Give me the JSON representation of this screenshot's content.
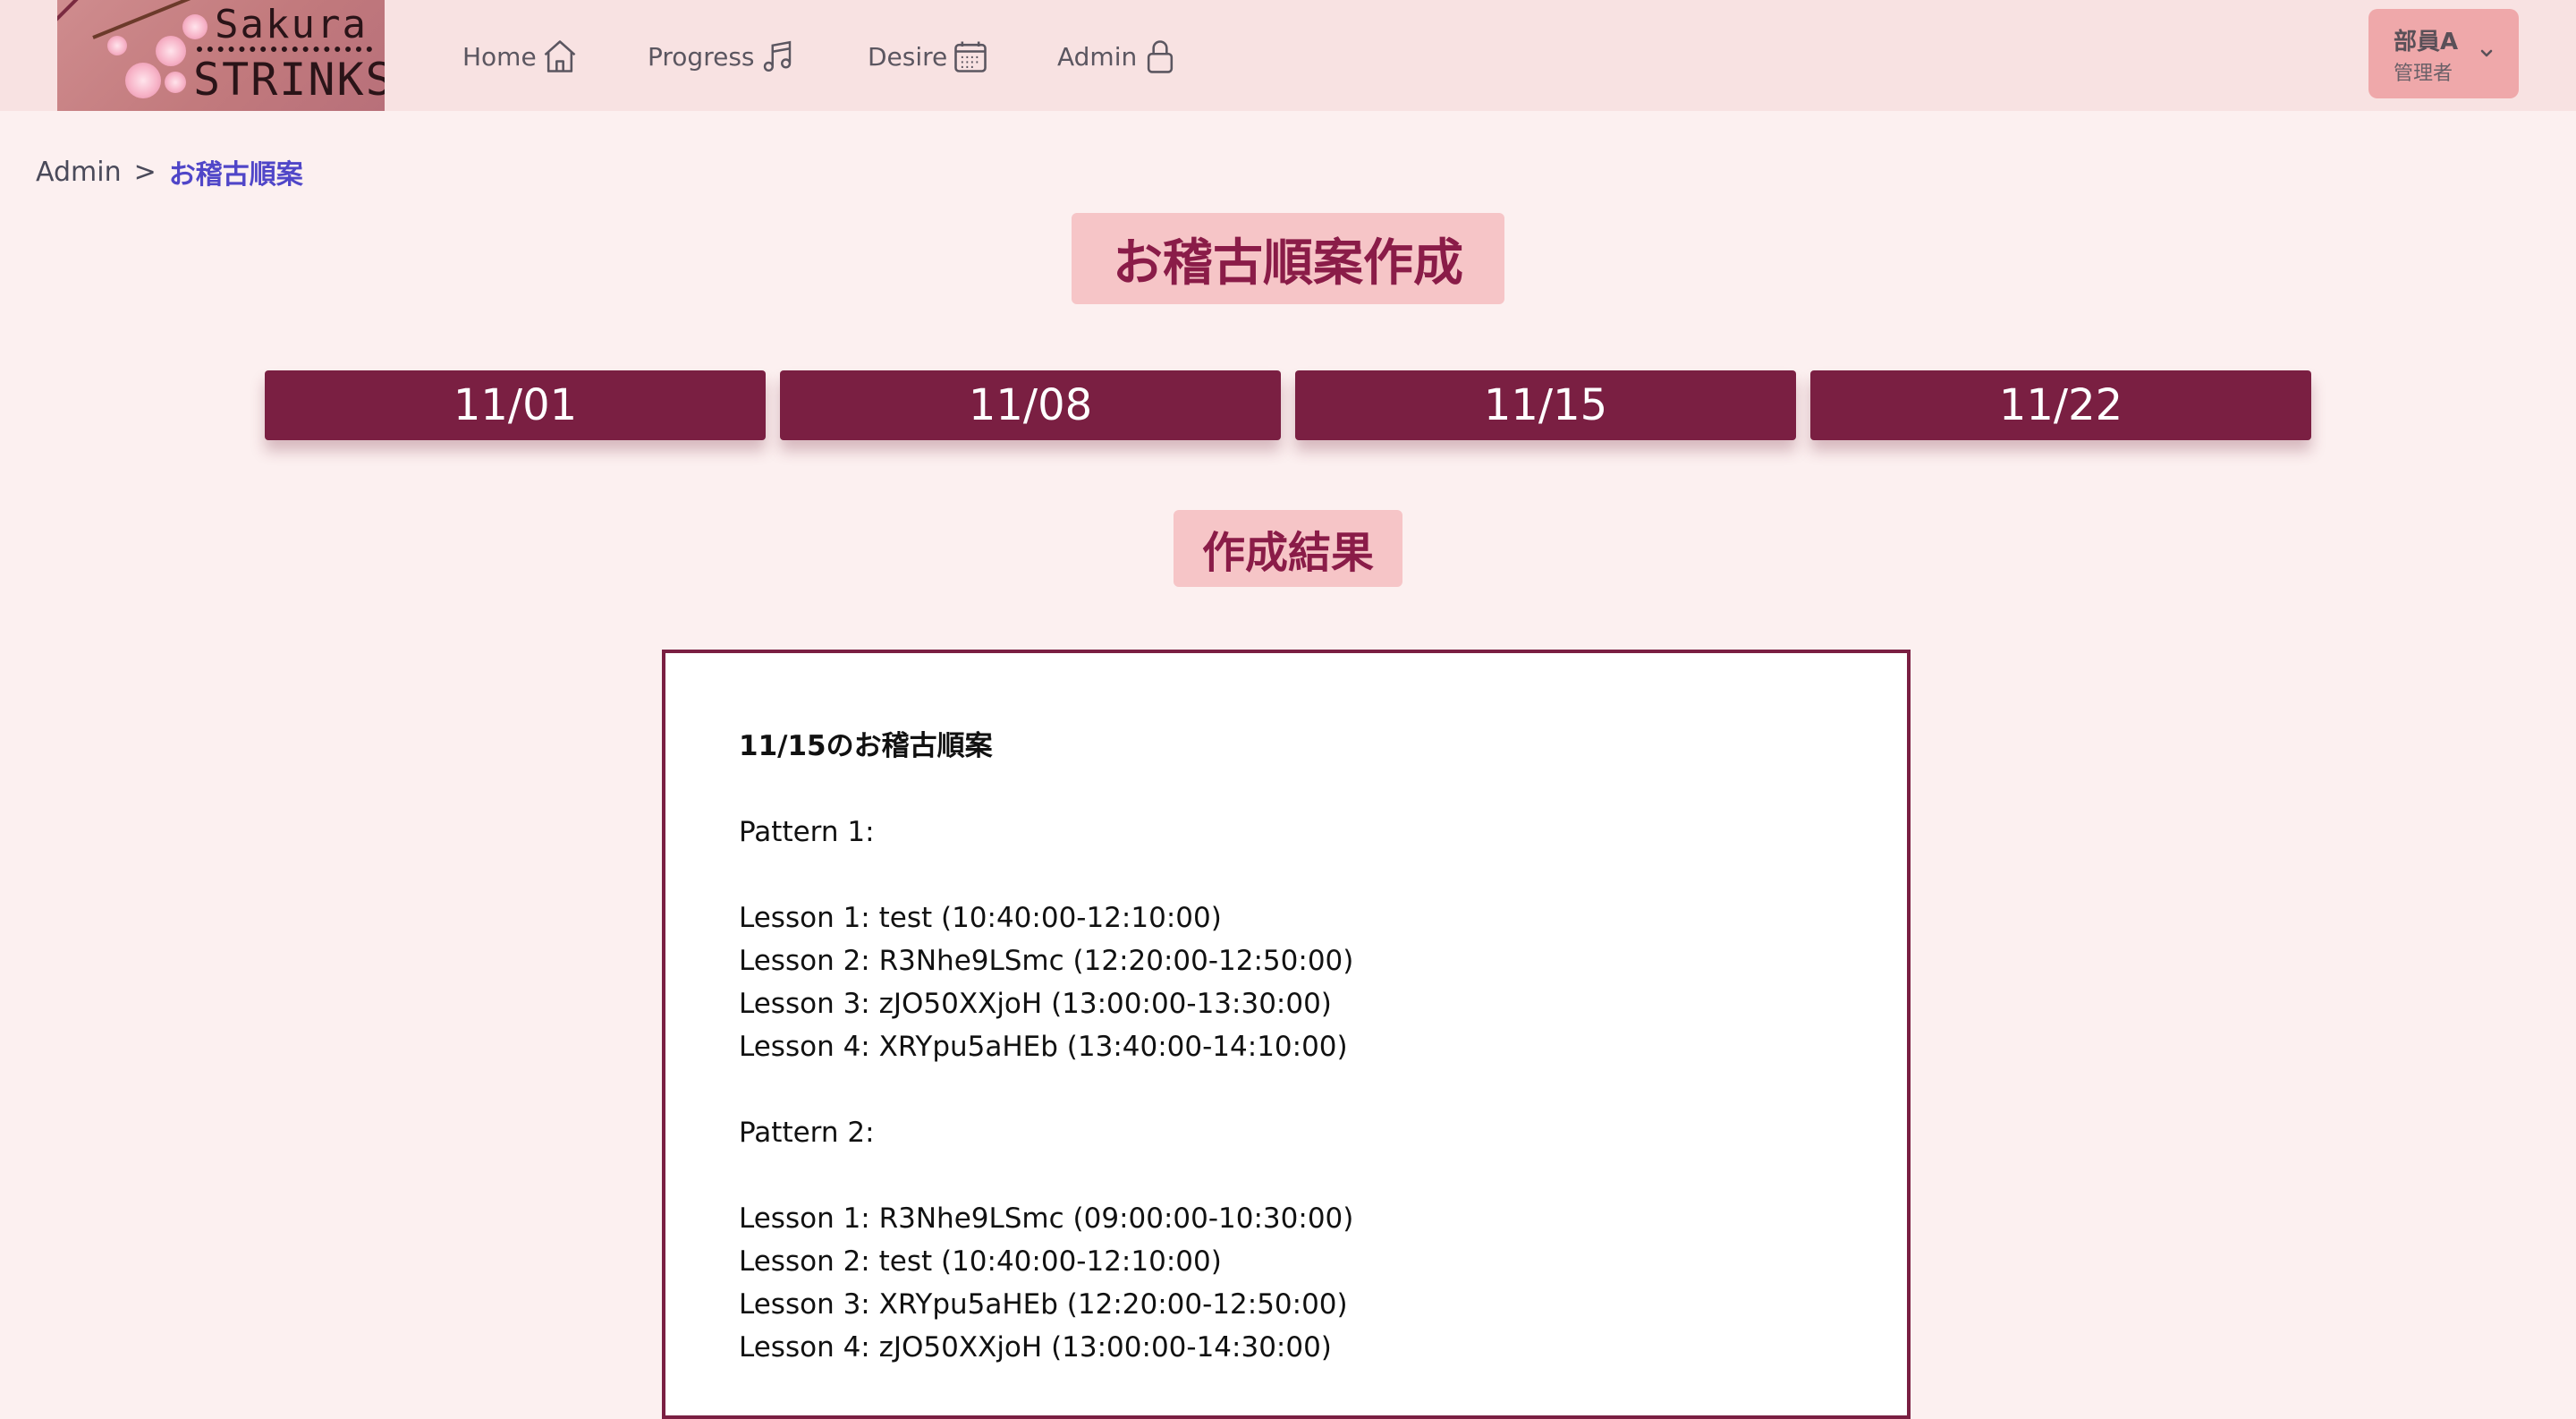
{
  "header": {
    "logo": {
      "line1": "Sakura",
      "line2": "STRINKS"
    },
    "nav": [
      {
        "label": "Home",
        "icon": "home-icon"
      },
      {
        "label": "Progress",
        "icon": "music-note-icon"
      },
      {
        "label": "Desire",
        "icon": "calendar-icon"
      },
      {
        "label": "Admin",
        "icon": "lock-icon"
      }
    ],
    "user": {
      "name": "部員A",
      "role": "管理者",
      "icon": "chevron-down-icon"
    }
  },
  "breadcrumb": {
    "root": "Admin",
    "separator": ">",
    "current": "お稽古順案"
  },
  "title": "お稽古順案作成",
  "dates": [
    "11/01",
    "11/08",
    "11/15",
    "11/22"
  ],
  "result_label": "作成結果",
  "result": {
    "heading": "11/15のお稽古順案",
    "patterns": [
      {
        "label": "Pattern 1:",
        "lessons": [
          "Lesson 1: test (10:40:00-12:10:00)",
          "Lesson 2: R3Nhe9LSmc (12:20:00-12:50:00)",
          "Lesson 3: zJO50XXjoH (13:00:00-13:30:00)",
          "Lesson 4: XRYpu5aHEb (13:40:00-14:10:00)"
        ]
      },
      {
        "label": "Pattern 2:",
        "lessons": [
          "Lesson 1: R3Nhe9LSmc (09:00:00-10:30:00)",
          "Lesson 2: test (10:40:00-12:10:00)",
          "Lesson 3: XRYpu5aHEb (12:20:00-12:50:00)",
          "Lesson 4: zJO50XXjoH (13:00:00-14:30:00)"
        ]
      }
    ]
  },
  "colors": {
    "page_bg": "#fcf0f0",
    "header_bg": "#f8e2e2",
    "primary": "#7a1f42",
    "title_bg": "#f6c5c7",
    "title_text": "#8a1c48",
    "link": "#5046c8"
  }
}
